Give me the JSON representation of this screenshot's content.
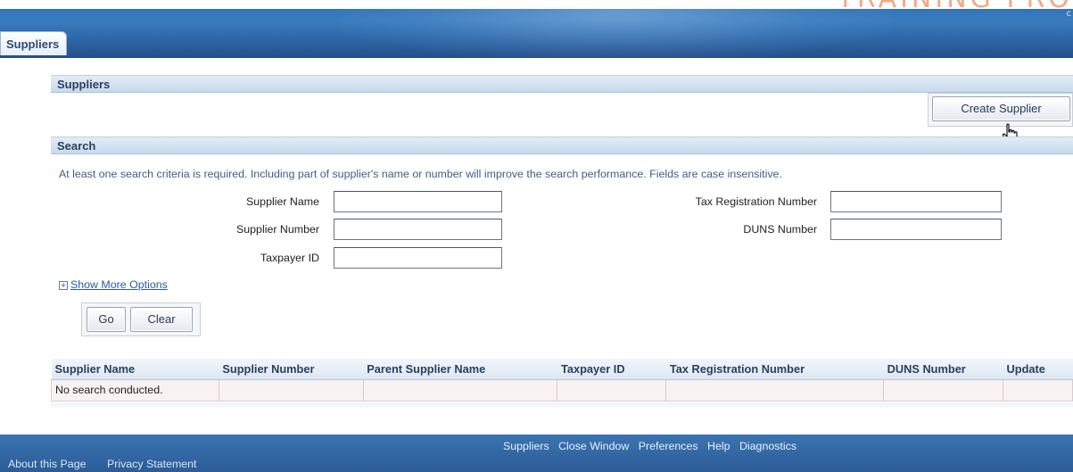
{
  "header": {
    "brand_text": "TRAINING PRO",
    "corner_glyph": "c",
    "tab_label": "Suppliers"
  },
  "suppliers_section": {
    "title": "Suppliers",
    "create_button": "Create Supplier"
  },
  "search_section": {
    "title": "Search",
    "hint": "At least one search criteria is required. Including part of supplier's name or number will improve the search performance. Fields are case insensitive.",
    "fields": {
      "supplier_name": {
        "label": "Supplier Name",
        "value": ""
      },
      "supplier_number": {
        "label": "Supplier Number",
        "value": ""
      },
      "taxpayer_id": {
        "label": "Taxpayer ID",
        "value": ""
      },
      "tax_registration_number": {
        "label": "Tax Registration Number",
        "value": ""
      },
      "duns_number": {
        "label": "DUNS Number",
        "value": ""
      }
    },
    "show_more_options": "Show More Options",
    "go_button": "Go",
    "clear_button": "Clear"
  },
  "results_table": {
    "columns": [
      "Supplier Name",
      "Supplier Number",
      "Parent Supplier Name",
      "Taxpayer ID",
      "Tax Registration Number",
      "DUNS Number",
      "Update"
    ],
    "empty_message": "No search conducted."
  },
  "footer": {
    "links": [
      "Suppliers",
      "Close Window",
      "Preferences",
      "Help",
      "Diagnostics"
    ],
    "left_links": [
      "About this Page",
      "Privacy Statement"
    ]
  },
  "colors": {
    "banner_blue": "#2d6db0",
    "section_header": "#c7d9ec",
    "link_blue": "#2a5aa6",
    "brand_orange": "#f0a07a"
  }
}
